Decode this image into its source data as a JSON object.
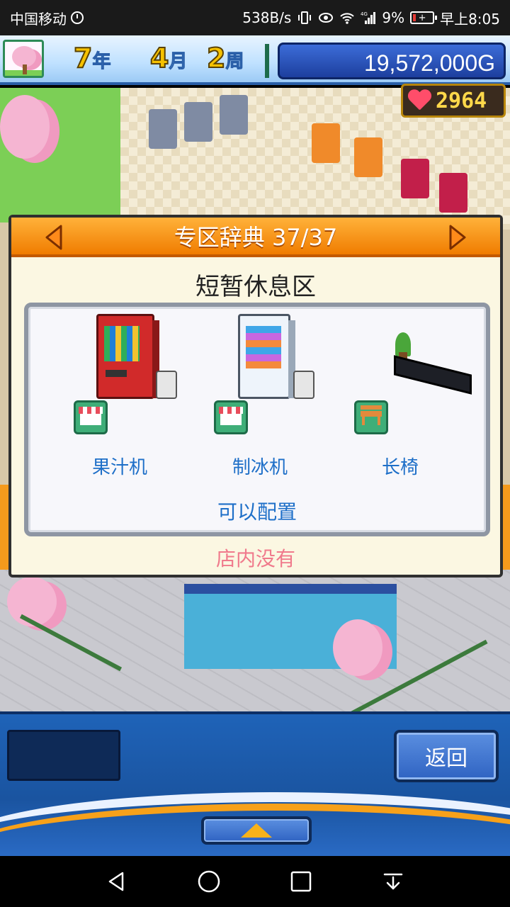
{
  "status_bar": {
    "carrier": "中国移动",
    "net_speed": "538B/s",
    "network_label": "4G",
    "battery_percent": "9%",
    "time": "早上8:05"
  },
  "hud": {
    "year_num": "7",
    "year_unit": "年",
    "month_num": "4",
    "month_unit": "月",
    "week_num": "2",
    "week_unit": "周",
    "money": "19,572,000G",
    "hearts": "2964"
  },
  "dialog": {
    "title": "专区辞典 37/37",
    "zone_name": "短暂休息区",
    "items": [
      {
        "label": "果汁机",
        "category_icon": "shop-icon"
      },
      {
        "label": "制冰机",
        "category_icon": "shop-icon"
      },
      {
        "label": "长椅",
        "category_icon": "bench-icon"
      }
    ],
    "configurable_text": "可以配置",
    "store_status": "店内没有"
  },
  "bottom": {
    "back_label": "返回"
  },
  "colors": {
    "accent_orange": "#f07c00",
    "item_text_blue": "#1e6fc8",
    "status_pink": "#f07a8c",
    "money_panel": "#1d3f9e"
  }
}
